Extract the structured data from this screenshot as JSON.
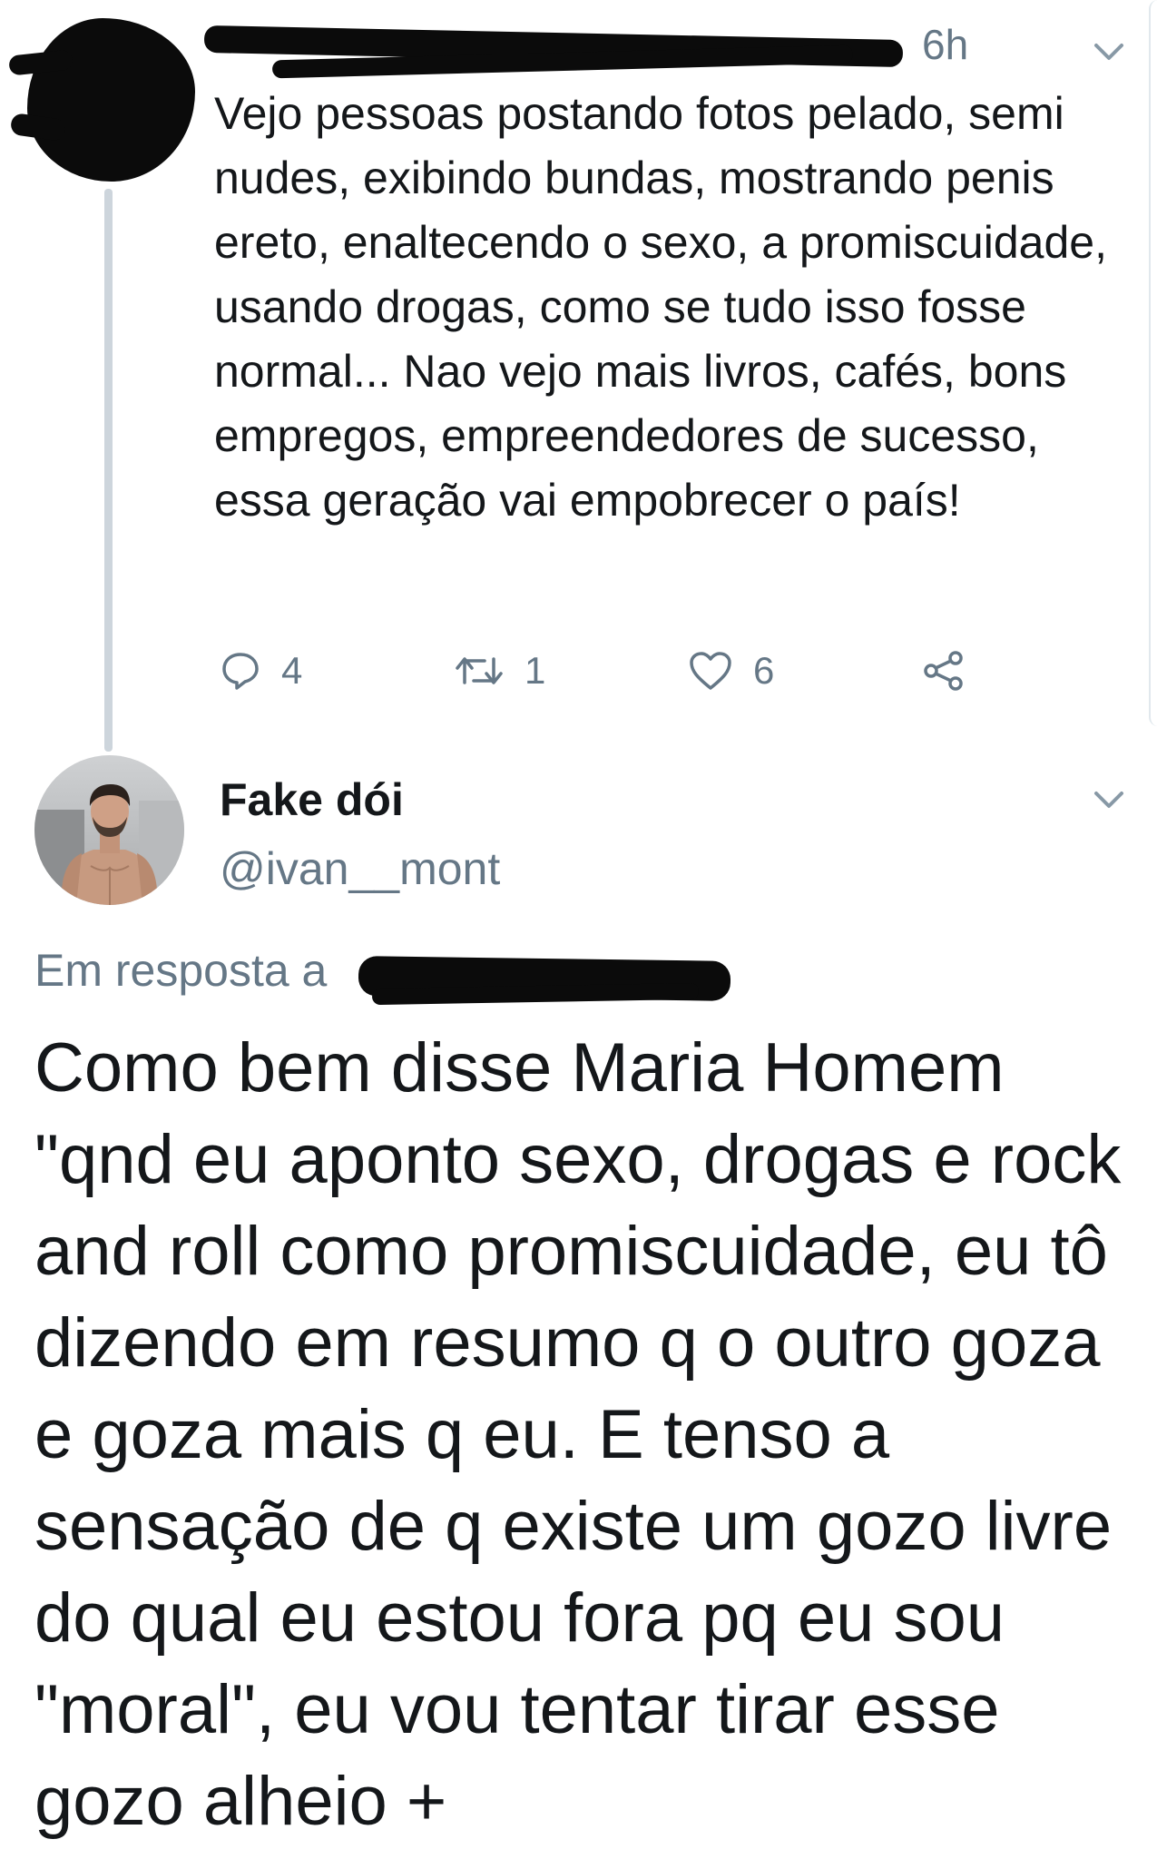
{
  "parent_tweet": {
    "time": "6h",
    "text": "Vejo pessoas postando fotos pelado, semi nudes, exibindo bundas, mostrando penis ereto, enaltecendo o sexo, a promiscuidade, usando drogas, como se tudo isso fosse normal... Nao vejo mais livros, cafés, bons empregos, empreendedores de sucesso, essa geração vai empobrecer o país!",
    "actions": {
      "reply_count": "4",
      "retweet_count": "1",
      "like_count": "6"
    }
  },
  "reply_tweet": {
    "display_name": "Fake dói",
    "handle": "@ivan__mont",
    "in_reply_to_label": "Em resposta a",
    "text": "Como bem disse Maria Homem \"qnd eu aponto sexo, drogas e rock and roll como promiscuidade, eu tô dizendo em resumo q o outro goza e goza mais q eu. E tenso a sensação de q existe um gozo livre do qual eu estou fora pq eu sou \"moral\", eu vou tentar tirar esse gozo alheio +"
  },
  "icons": {
    "reply": "reply-icon",
    "retweet": "retweet-icon",
    "like": "heart-icon",
    "share": "share-icon",
    "caret": "chevron-down-icon"
  },
  "colors": {
    "text": "#14171a",
    "secondary": "#657786",
    "thread_line": "#cdd5dc",
    "background": "#ffffff"
  }
}
